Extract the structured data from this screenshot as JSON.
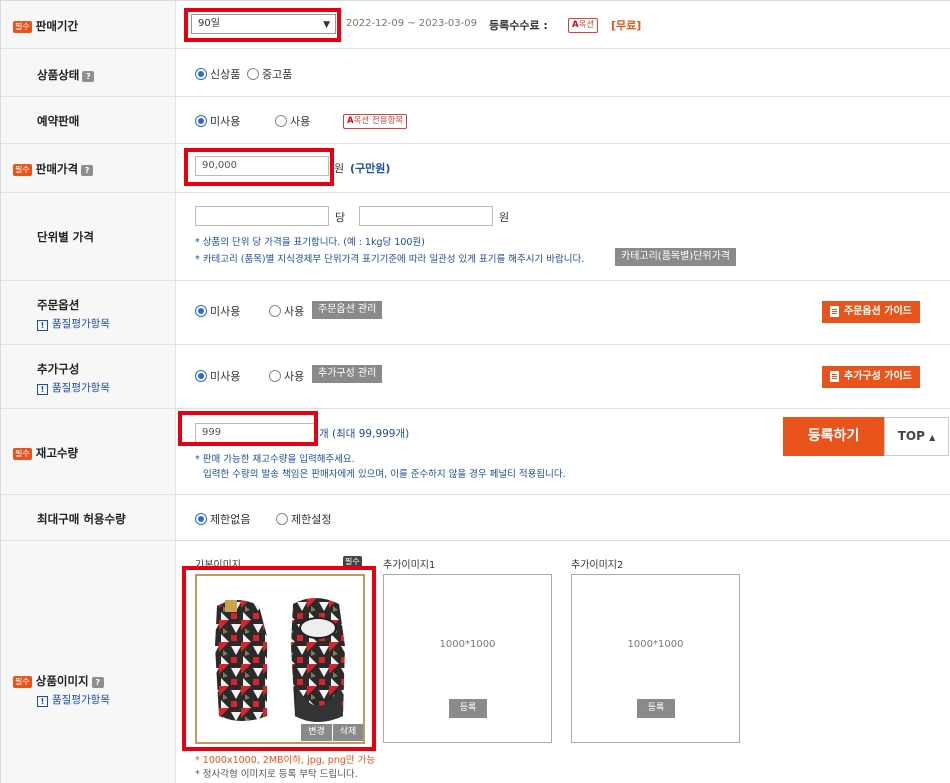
{
  "period": {
    "label": "판매기간",
    "required": "필수",
    "select": "90일",
    "range": "2022-12-09 ~ 2023-03-09",
    "fee_label": "등록수수료 :",
    "fee_badge": "옥션",
    "fee_value": "[무료]"
  },
  "condition": {
    "label": "상품상태",
    "help": "?",
    "options": [
      "신상품",
      "중고품"
    ],
    "selected": 0
  },
  "reservation": {
    "label": "예약판매",
    "options": [
      "미사용",
      "사용"
    ],
    "selected": 0,
    "badge": "옥션 전용항목"
  },
  "price": {
    "label": "판매가격",
    "required": "필수",
    "help": "?",
    "value": "90,000",
    "unit": "원",
    "hint": "(구만원)"
  },
  "unit_price": {
    "label": "단위별 가격",
    "per": "당",
    "unit": "원",
    "note1": "* 상품의 단위 당 가격을 표기합니다. (예 : 1kg당 100원)",
    "note2": "* 카테고리 (품목)별 지식경제부 단위가격 표기기준에 따라 일관성 있게 표기를 해주시기 바랍니다.",
    "button": "카테고리(품목별)단위가격"
  },
  "order_option": {
    "label": "주문옵션",
    "quality": "품질평가항목",
    "options": [
      "미사용",
      "사용"
    ],
    "selected": 0,
    "manage": "주문옵션 관리",
    "guide": "주문옵션 가이드"
  },
  "extra": {
    "label": "추가구성",
    "quality": "품질평가항목",
    "options": [
      "미사용",
      "사용"
    ],
    "selected": 0,
    "manage": "추가구성 관리",
    "guide": "추가구성 가이드"
  },
  "stock": {
    "label": "재고수량",
    "required": "필수",
    "value": "999",
    "unit": "개 (최대 99,999개)",
    "note1": "* 판매 가능한 재고수량을 입력해주세요.",
    "note2": "입력한 수량의 발송 책임은 판매자에게 있으며, 이를 준수하지 않을 경우 페널티 적용됩니다.",
    "register": "등록하기",
    "top": "TOP"
  },
  "max_buy": {
    "label": "최대구매 허용수량",
    "options": [
      "제한없음",
      "제한설정"
    ],
    "selected": 0
  },
  "images": {
    "label": "상품이미지",
    "required": "필수",
    "help": "?",
    "quality": "품질평가항목",
    "main_title": "기본이미지",
    "main_required": "필수",
    "extra1_title": "추가이미지1",
    "extra2_title": "추가이미지2",
    "placeholder": "1000*1000",
    "register": "등록",
    "change": "변경",
    "delete": "삭제",
    "note1": "* 1000x1000, 2MB이하, jpg, png만 가능",
    "note2": "* 정사각형 이미지로 등록 부탁 드립니다."
  },
  "colors": {
    "accent": "#e8541c",
    "link": "#1d4ea2",
    "highlight": "#e60012"
  }
}
